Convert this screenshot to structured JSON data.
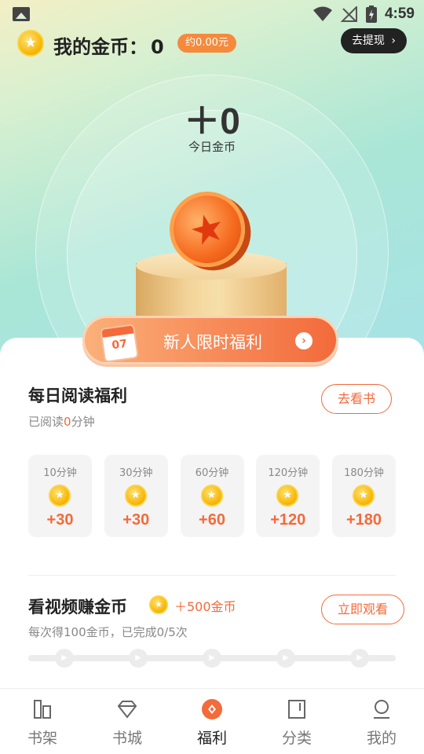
{
  "status_bar": {
    "time": "4:59"
  },
  "header": {
    "title": "我的金币：",
    "coin_count": "0",
    "approx_value": "约0.00元",
    "withdraw_label": "去提现"
  },
  "today": {
    "amount": "＋0",
    "label": "今日金币"
  },
  "promo": {
    "label": "新人限时福利",
    "calendar_day": "07"
  },
  "daily_reading": {
    "title": "每日阅读福利",
    "read_prefix": "已阅读",
    "read_minutes": "0",
    "read_suffix": "分钟",
    "button_label": "去看书",
    "rewards": [
      {
        "duration": "10分钟",
        "amount": "+30"
      },
      {
        "duration": "30分钟",
        "amount": "+30"
      },
      {
        "duration": "60分钟",
        "amount": "+60"
      },
      {
        "duration": "120分钟",
        "amount": "+120"
      },
      {
        "duration": "180分钟",
        "amount": "+180"
      }
    ]
  },
  "video_reward": {
    "title": "看视频赚金币",
    "bonus": "＋500金币",
    "subtitle": "每次得100金币，已完成0/5次",
    "button_label": "立即观看",
    "completed": 0,
    "total": 5
  },
  "tabs": [
    {
      "label": "书架",
      "icon": "bookshelf-icon",
      "active": false
    },
    {
      "label": "书城",
      "icon": "diamond-icon",
      "active": false
    },
    {
      "label": "福利",
      "icon": "welfare-icon",
      "active": true
    },
    {
      "label": "分类",
      "icon": "category-icon",
      "active": false
    },
    {
      "label": "我的",
      "icon": "profile-icon",
      "active": false
    }
  ],
  "colors": {
    "accent": "#f36a3b",
    "gold": "#f5b400",
    "dark": "#222222"
  }
}
